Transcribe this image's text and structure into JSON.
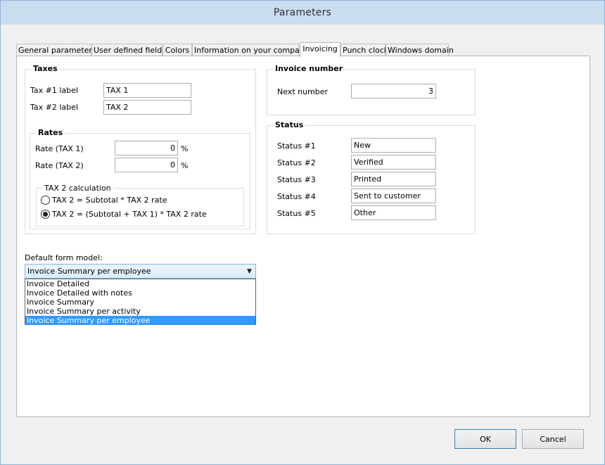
{
  "window": {
    "title": "Parameters"
  },
  "tabs": [
    {
      "label": "General parameters"
    },
    {
      "label": "User defined fields"
    },
    {
      "label": "Colors"
    },
    {
      "label": "Information on your company"
    },
    {
      "label": "Invoicing"
    },
    {
      "label": "Punch clock"
    },
    {
      "label": "Windows domain"
    }
  ],
  "active_tab": "Invoicing",
  "taxes": {
    "title": "Taxes",
    "tax1_label": "Tax #1 label",
    "tax1_value": "TAX 1",
    "tax2_label": "Tax #2 label",
    "tax2_value": "TAX 2",
    "rates": {
      "title": "Rates",
      "rate1_label": "Rate (TAX 1)",
      "rate1_value": "0",
      "rate2_label": "Rate (TAX 2)",
      "rate2_value": "0",
      "percent": "%"
    },
    "calc": {
      "title": "TAX 2 calculation",
      "option1": "TAX 2 = Subtotal * TAX 2 rate",
      "option2": "TAX 2 = (Subtotal + TAX 1) * TAX 2 rate",
      "selected": 2
    }
  },
  "invoice_number": {
    "title": "Invoice number",
    "next_label": "Next number",
    "next_value": "3"
  },
  "status": {
    "title": "Status",
    "items": [
      {
        "label": "Status #1",
        "value": "New"
      },
      {
        "label": "Status #2",
        "value": "Verified"
      },
      {
        "label": "Status #3",
        "value": "Printed"
      },
      {
        "label": "Status #4",
        "value": "Sent to customer"
      },
      {
        "label": "Status #5",
        "value": "Other"
      }
    ]
  },
  "form_model": {
    "label": "Default form model:",
    "selected": "Invoice Summary per employee",
    "options": [
      "Invoice Detailed",
      "Invoice Detailed with notes",
      "Invoice Summary",
      "Invoice Summary per activity",
      "Invoice Summary per employee"
    ]
  },
  "buttons": {
    "ok": "OK",
    "cancel": "Cancel"
  }
}
